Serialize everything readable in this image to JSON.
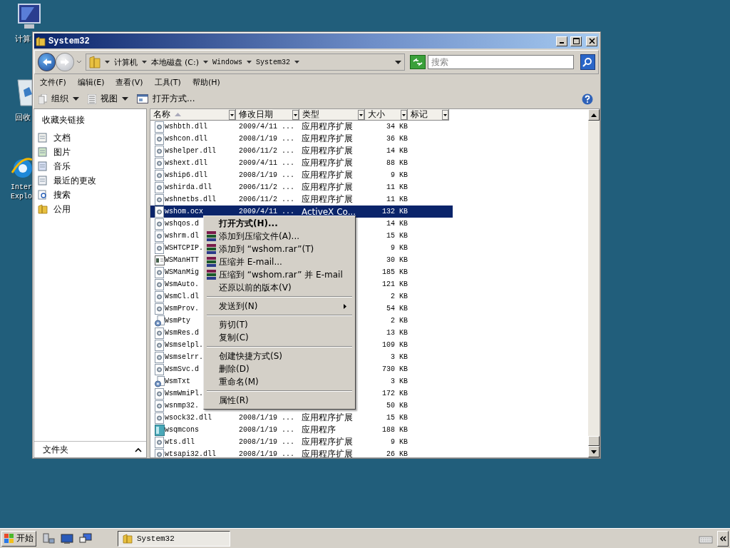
{
  "desktop_icons": [
    {
      "lines": [
        "计算"
      ],
      "kind": "computer"
    },
    {
      "lines": [
        "回收"
      ],
      "kind": "recycle"
    },
    {
      "lines": [
        "Inter",
        "Explo"
      ],
      "kind": "browser"
    }
  ],
  "window": {
    "title": "System32"
  },
  "address": {
    "crumbs": [
      "计算机",
      "本地磁盘 (C:)",
      "Windows",
      "System32"
    ]
  },
  "search": {
    "placeholder": "搜索"
  },
  "menubar": [
    "文件(F)",
    "编辑(E)",
    "查看(V)",
    "工具(T)",
    "帮助(H)"
  ],
  "toolbar": [
    {
      "label": "组织",
      "kind": "organize",
      "dropdown": true
    },
    {
      "label": "视图",
      "kind": "views",
      "dropdown": true
    },
    {
      "label": "打开方式...",
      "kind": "open",
      "dropdown": false
    }
  ],
  "sidebar": {
    "header": "收藏夹链接",
    "items": [
      {
        "label": "文档",
        "kind": "doc"
      },
      {
        "label": "图片",
        "kind": "pic"
      },
      {
        "label": "音乐",
        "kind": "music"
      },
      {
        "label": "最近的更改",
        "kind": "recent"
      },
      {
        "label": "搜索",
        "kind": "search"
      },
      {
        "label": "公用",
        "kind": "folder"
      }
    ],
    "footer": "文件夹"
  },
  "columns": [
    {
      "label": "名称",
      "sorted": true
    },
    {
      "label": "修改日期",
      "sorted": false
    },
    {
      "label": "类型",
      "sorted": false
    },
    {
      "label": "大小",
      "sorted": false
    },
    {
      "label": "标记",
      "sorted": false
    }
  ],
  "rows": [
    {
      "name": "wshbth.dll",
      "date": "2009/4/11 ...",
      "type": "应用程序扩展",
      "size": "34 KB",
      "kind": "dll",
      "selected": false
    },
    {
      "name": "wshcon.dll",
      "date": "2008/1/19 ...",
      "type": "应用程序扩展",
      "size": "36 KB",
      "kind": "dll",
      "selected": false
    },
    {
      "name": "wshelper.dll",
      "date": "2006/11/2 ...",
      "type": "应用程序扩展",
      "size": "14 KB",
      "kind": "dll",
      "selected": false
    },
    {
      "name": "wshext.dll",
      "date": "2009/4/11 ...",
      "type": "应用程序扩展",
      "size": "88 KB",
      "kind": "dll",
      "selected": false
    },
    {
      "name": "wship6.dll",
      "date": "2008/1/19 ...",
      "type": "应用程序扩展",
      "size": "9 KB",
      "kind": "dll",
      "selected": false
    },
    {
      "name": "wshirda.dll",
      "date": "2006/11/2 ...",
      "type": "应用程序扩展",
      "size": "11 KB",
      "kind": "dll",
      "selected": false
    },
    {
      "name": "wshnetbs.dll",
      "date": "2006/11/2 ...",
      "type": "应用程序扩展",
      "size": "11 KB",
      "kind": "dll",
      "selected": false
    },
    {
      "name": "wshom.ocx",
      "date": "2009/4/11 ...",
      "type": "ActiveX Co...",
      "size": "132 KB",
      "kind": "dll",
      "selected": true
    },
    {
      "name": "wshqos.d",
      "size": "14 KB",
      "kind": "dll",
      "selected": false
    },
    {
      "name": "wshrm.dl",
      "size": "15 KB",
      "kind": "dll",
      "selected": false
    },
    {
      "name": "WSHTCPIP.",
      "size": "9 KB",
      "kind": "dll",
      "selected": false
    },
    {
      "name": "WSManHTT",
      "size": "30 KB",
      "kind": "window",
      "selected": false
    },
    {
      "name": "WSManMig",
      "size": "185 KB",
      "kind": "dll",
      "selected": false
    },
    {
      "name": "WsmAuto.",
      "size": "121 KB",
      "kind": "dll",
      "selected": false
    },
    {
      "name": "WsmCl.dl",
      "size": "2 KB",
      "kind": "dll",
      "selected": false
    },
    {
      "name": "WsmProv.",
      "size": "54 KB",
      "kind": "dll",
      "selected": false
    },
    {
      "name": "WsmPty",
      "size": "2 KB",
      "kind": "gears",
      "selected": false
    },
    {
      "name": "WsmRes.d",
      "size": "13 KB",
      "kind": "dll",
      "selected": false
    },
    {
      "name": "Wsmselpl.",
      "size": "109 KB",
      "kind": "dll",
      "selected": false
    },
    {
      "name": "Wsmselrr.",
      "size": "3 KB",
      "kind": "dll",
      "selected": false
    },
    {
      "name": "WsmSvc.d",
      "size": "730 KB",
      "kind": "dll",
      "selected": false
    },
    {
      "name": "WsmTxt",
      "size": "3 KB",
      "kind": "gears",
      "selected": false
    },
    {
      "name": "WsmWmiPl.",
      "size": "172 KB",
      "kind": "dll",
      "selected": false
    },
    {
      "name": "wsnmp32.",
      "size": "50 KB",
      "kind": "dll",
      "selected": false
    },
    {
      "name": "wsock32.dll",
      "date": "2008/1/19 ...",
      "type": "应用程序扩展",
      "size": "15 KB",
      "kind": "dll",
      "selected": false
    },
    {
      "name": "wsqmcons",
      "date": "2008/1/19 ...",
      "type": "应用程序",
      "size": "188 KB",
      "kind": "app",
      "selected": false
    },
    {
      "name": "wts.dll",
      "date": "2008/1/19 ...",
      "type": "应用程序扩展",
      "size": "9 KB",
      "kind": "dll",
      "selected": false
    },
    {
      "name": "wtsapi32.dll",
      "date": "2008/1/19 ...",
      "type": "应用程序扩展",
      "size": "26 KB",
      "kind": "dll",
      "selected": false
    }
  ],
  "context_menu": [
    {
      "kind": "item",
      "label": "打开方式(H)...",
      "bold": true,
      "submenu": false
    },
    {
      "kind": "archive",
      "label": "添加到压缩文件(A)...",
      "bold": false,
      "submenu": false
    },
    {
      "kind": "archive",
      "label": "添加到 “wshom.rar”(T)",
      "bold": false,
      "submenu": false
    },
    {
      "kind": "archive",
      "label": "压缩并 E-mail...",
      "bold": false,
      "submenu": false
    },
    {
      "kind": "archive",
      "label": "压缩到 “wshom.rar” 并 E-mail",
      "bold": false,
      "submenu": false
    },
    {
      "kind": "item",
      "label": "还原以前的版本(V)",
      "bold": false,
      "submenu": false
    },
    {
      "kind": "separator"
    },
    {
      "kind": "item",
      "label": "发送到(N)",
      "bold": false,
      "submenu": true
    },
    {
      "kind": "separator"
    },
    {
      "kind": "item",
      "label": "剪切(T)",
      "bold": false,
      "submenu": false
    },
    {
      "kind": "item",
      "label": "复制(C)",
      "bold": false,
      "submenu": false
    },
    {
      "kind": "separator"
    },
    {
      "kind": "item",
      "label": "创建快捷方式(S)",
      "bold": false,
      "submenu": false
    },
    {
      "kind": "item",
      "label": "删除(D)",
      "bold": false,
      "submenu": false
    },
    {
      "kind": "item",
      "label": "重命名(M)",
      "bold": false,
      "submenu": false
    },
    {
      "kind": "separator"
    },
    {
      "kind": "item",
      "label": "属性(R)",
      "bold": false,
      "submenu": false
    }
  ],
  "taskbar": {
    "start": "开始",
    "tasks": [
      {
        "label": "System32"
      }
    ]
  }
}
